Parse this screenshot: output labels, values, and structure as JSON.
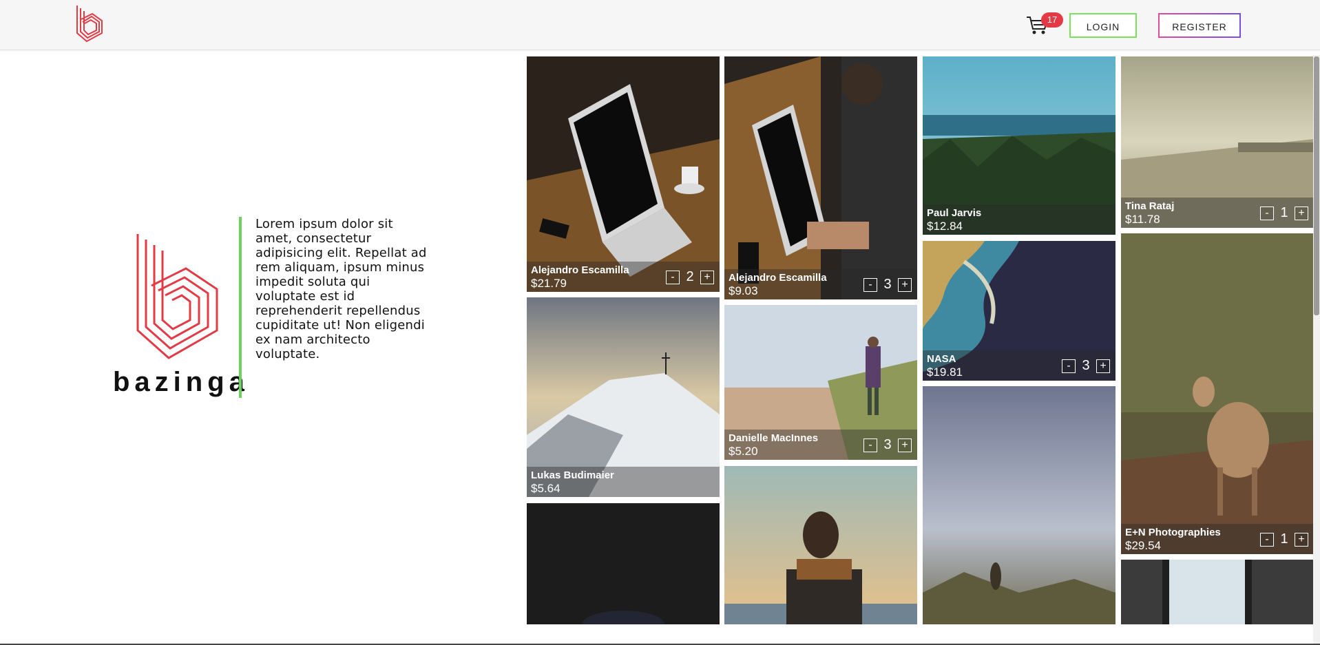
{
  "header": {
    "cart_count": "17",
    "login_label": "LOGIN",
    "register_label": "REGISTER"
  },
  "hero": {
    "brand": "bazinga",
    "blurb": "Lorem ipsum dolor sit amet, consectetur adipisicing elit. Repellat ad rem aliquam, ipsum minus impedit soluta qui voluptate est id reprehenderit repellendus cupiditate ut! Non eligendi ex nam architecto voluptate."
  },
  "colors": {
    "brand_red": "#e23b45",
    "login_border": "#7be05a",
    "divider_green": "#6bd35a"
  },
  "gallery": {
    "tiles": [
      {
        "author": "Alejandro Escamilla",
        "price": "$21.79",
        "qty": "2"
      },
      {
        "author": "Lukas Budimaier",
        "price": "$5.64"
      },
      {
        "author": "Alejandro Escamilla",
        "price": "$9.03",
        "qty": "3"
      },
      {
        "author": "Danielle MacInnes",
        "price": "$5.20",
        "qty": "3"
      },
      {
        "author": "Paul Jarvis",
        "price": "$12.84"
      },
      {
        "author": "NASA",
        "price": "$19.81",
        "qty": "3"
      },
      {
        "author": "Tina Rataj",
        "price": "$11.78",
        "qty": "1"
      },
      {
        "author": "E+N Photographies",
        "price": "$29.54",
        "qty": "1"
      }
    ],
    "minus_label": "-",
    "plus_label": "+"
  }
}
